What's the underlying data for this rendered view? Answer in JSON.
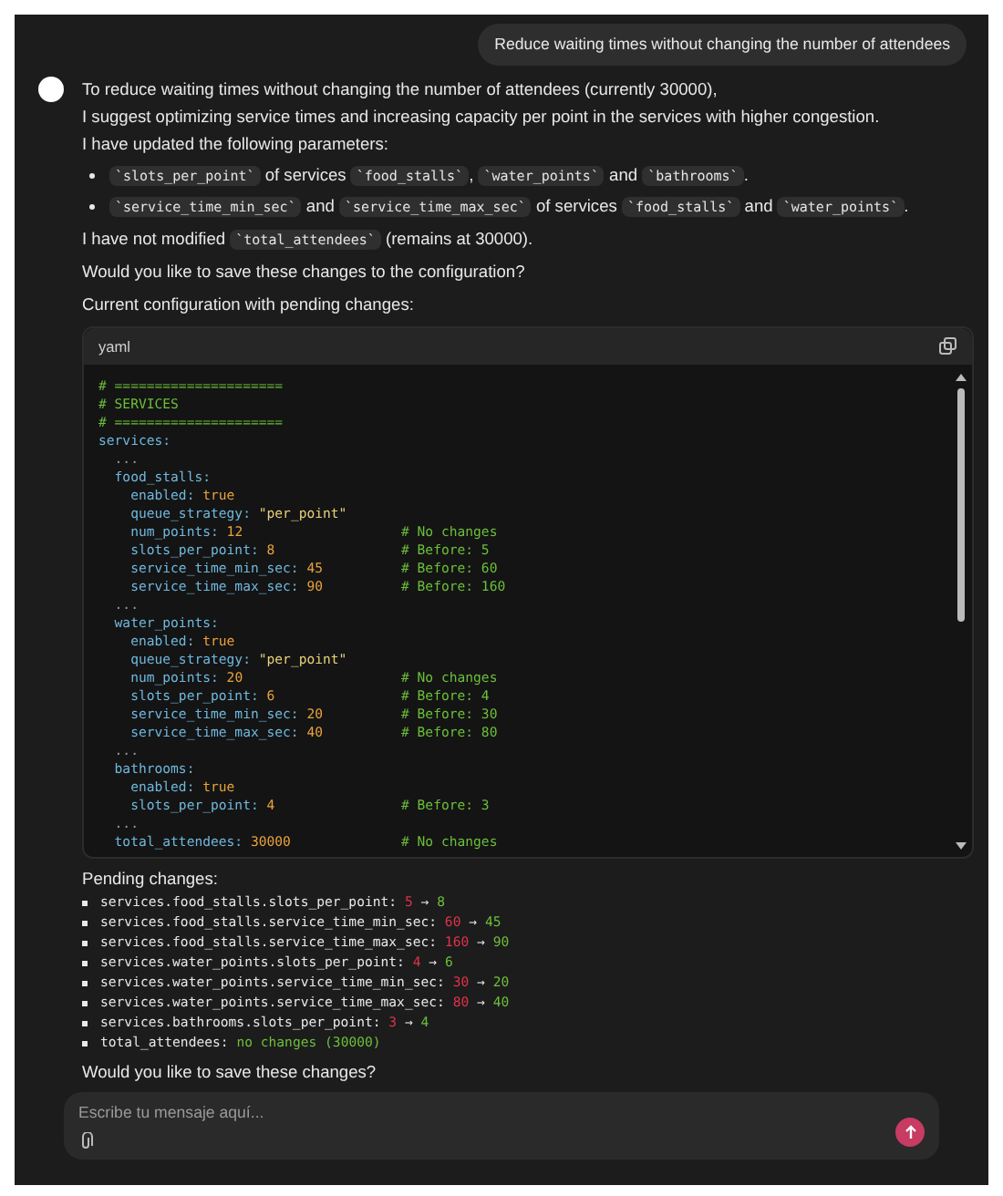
{
  "user_message": "Reduce waiting times without changing the number of attendees",
  "assistant": {
    "paragraphs_top": [
      [
        {
          "kind": "text",
          "text": "To reduce waiting times without changing the number of attendees (currently 30000),"
        }
      ],
      [
        {
          "kind": "text",
          "text": "I suggest optimizing service times and increasing capacity per point in the services with higher congestion."
        }
      ],
      [
        {
          "kind": "text",
          "text": "I have updated the following parameters:"
        }
      ]
    ],
    "bullets": [
      [
        {
          "kind": "code",
          "text": "`slots_per_point`"
        },
        {
          "kind": "text",
          "text": " of services "
        },
        {
          "kind": "code",
          "text": "`food_stalls`"
        },
        {
          "kind": "text",
          "text": ", "
        },
        {
          "kind": "code",
          "text": "`water_points`"
        },
        {
          "kind": "text",
          "text": " and "
        },
        {
          "kind": "code",
          "text": "`bathrooms`"
        },
        {
          "kind": "text",
          "text": "."
        }
      ],
      [
        {
          "kind": "code",
          "text": "`service_time_min_sec`"
        },
        {
          "kind": "text",
          "text": " and "
        },
        {
          "kind": "code",
          "text": "`service_time_max_sec`"
        },
        {
          "kind": "text",
          "text": " of services "
        },
        {
          "kind": "code",
          "text": "`food_stalls`"
        },
        {
          "kind": "text",
          "text": " and "
        },
        {
          "kind": "code",
          "text": "`water_points`"
        },
        {
          "kind": "text",
          "text": "."
        }
      ]
    ],
    "paragraphs_mid": [
      [
        {
          "kind": "text",
          "text": "I have not modified "
        },
        {
          "kind": "code",
          "text": "`total_attendees`"
        },
        {
          "kind": "text",
          "text": " (remains at 30000)."
        }
      ],
      [
        {
          "kind": "text",
          "text": "Would you like to save these changes to the configuration?"
        }
      ],
      [
        {
          "kind": "text",
          "text": "Current configuration with pending changes:"
        }
      ]
    ],
    "code_block": {
      "language": "yaml",
      "lines": [
        [
          {
            "kind": "comment",
            "text": "# ====================="
          }
        ],
        [
          {
            "kind": "comment",
            "text": "# SERVICES"
          }
        ],
        [
          {
            "kind": "comment",
            "text": "# ====================="
          }
        ],
        [
          {
            "kind": "key",
            "text": "services:"
          }
        ],
        [
          {
            "kind": "plain",
            "text": "  ..."
          }
        ],
        [
          {
            "kind": "key",
            "text": "  food_stalls:"
          }
        ],
        [
          {
            "kind": "key",
            "text": "    enabled: "
          },
          {
            "kind": "value",
            "text": "true"
          }
        ],
        [
          {
            "kind": "key",
            "text": "    queue_strategy: "
          },
          {
            "kind": "string",
            "text": "\"per_point\""
          }
        ],
        [
          {
            "kind": "key",
            "text": "    num_points: "
          },
          {
            "kind": "value",
            "text": "12"
          },
          {
            "kind": "comment",
            "text": "# No changes"
          }
        ],
        [
          {
            "kind": "key",
            "text": "    slots_per_point: "
          },
          {
            "kind": "value",
            "text": "8"
          },
          {
            "kind": "comment",
            "text": "# Before: 5"
          }
        ],
        [
          {
            "kind": "key",
            "text": "    service_time_min_sec: "
          },
          {
            "kind": "value",
            "text": "45"
          },
          {
            "kind": "comment",
            "text": "# Before: 60"
          }
        ],
        [
          {
            "kind": "key",
            "text": "    service_time_max_sec: "
          },
          {
            "kind": "value",
            "text": "90"
          },
          {
            "kind": "comment",
            "text": "# Before: 160"
          }
        ],
        [
          {
            "kind": "plain",
            "text": "  ..."
          }
        ],
        [
          {
            "kind": "key",
            "text": "  water_points:"
          }
        ],
        [
          {
            "kind": "key",
            "text": "    enabled: "
          },
          {
            "kind": "value",
            "text": "true"
          }
        ],
        [
          {
            "kind": "key",
            "text": "    queue_strategy: "
          },
          {
            "kind": "string",
            "text": "\"per_point\""
          }
        ],
        [
          {
            "kind": "key",
            "text": "    num_points: "
          },
          {
            "kind": "value",
            "text": "20"
          },
          {
            "kind": "comment",
            "text": "# No changes"
          }
        ],
        [
          {
            "kind": "key",
            "text": "    slots_per_point: "
          },
          {
            "kind": "value",
            "text": "6"
          },
          {
            "kind": "comment",
            "text": "# Before: 4"
          }
        ],
        [
          {
            "kind": "key",
            "text": "    service_time_min_sec: "
          },
          {
            "kind": "value",
            "text": "20"
          },
          {
            "kind": "comment",
            "text": "# Before: 30"
          }
        ],
        [
          {
            "kind": "key",
            "text": "    service_time_max_sec: "
          },
          {
            "kind": "value",
            "text": "40"
          },
          {
            "kind": "comment",
            "text": "# Before: 80"
          }
        ],
        [
          {
            "kind": "plain",
            "text": "  ..."
          }
        ],
        [
          {
            "kind": "key",
            "text": "  bathrooms:"
          }
        ],
        [
          {
            "kind": "key",
            "text": "    enabled: "
          },
          {
            "kind": "value",
            "text": "true"
          }
        ],
        [
          {
            "kind": "key",
            "text": "    slots_per_point: "
          },
          {
            "kind": "value",
            "text": "4"
          },
          {
            "kind": "comment",
            "text": "# Before: 3"
          }
        ],
        [
          {
            "kind": "plain",
            "text": "  ..."
          }
        ],
        [
          {
            "kind": "key",
            "text": "  total_attendees: "
          },
          {
            "kind": "value",
            "text": "30000"
          },
          {
            "kind": "comment",
            "text": "# No changes"
          }
        ]
      ]
    },
    "pending_title": "Pending changes:",
    "pending": [
      {
        "kind": "change",
        "path": "services.food_stalls.slots_per_point:",
        "before": "5",
        "arrow": "→",
        "after": "8"
      },
      {
        "kind": "change",
        "path": "services.food_stalls.service_time_min_sec:",
        "before": "60",
        "arrow": "→",
        "after": "45"
      },
      {
        "kind": "change",
        "path": "services.food_stalls.service_time_max_sec:",
        "before": "160",
        "arrow": "→",
        "after": "90"
      },
      {
        "kind": "change",
        "path": "services.water_points.slots_per_point:",
        "before": "4",
        "arrow": "→",
        "after": "6"
      },
      {
        "kind": "change",
        "path": "services.water_points.service_time_min_sec:",
        "before": "30",
        "arrow": "→",
        "after": "20"
      },
      {
        "kind": "change",
        "path": "services.water_points.service_time_max_sec:",
        "before": "80",
        "arrow": "→",
        "after": "40"
      },
      {
        "kind": "change",
        "path": "services.bathrooms.slots_per_point:",
        "before": "3",
        "arrow": "→",
        "after": "4"
      },
      {
        "kind": "note",
        "path": "total_attendees:",
        "after": "no changes (30000)"
      }
    ],
    "closing": "Would you like to save these changes?"
  },
  "composer": {
    "placeholder": "Escribe tu mensaje aquí..."
  }
}
